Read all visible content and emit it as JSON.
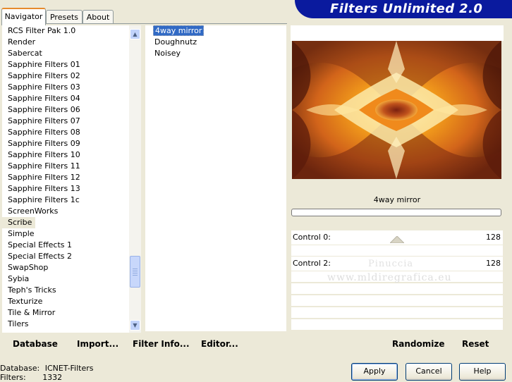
{
  "tabs": {
    "navigator": "Navigator",
    "presets": "Presets",
    "about": "About"
  },
  "app_title": "Filters Unlimited 2.0",
  "categories": [
    "RCS Filter Pak 1.0",
    "Render",
    "Sabercat",
    "Sapphire Filters 01",
    "Sapphire Filters 02",
    "Sapphire Filters 03",
    "Sapphire Filters 04",
    "Sapphire Filters 06",
    "Sapphire Filters 07",
    "Sapphire Filters 08",
    "Sapphire Filters 09",
    "Sapphire Filters 10",
    "Sapphire Filters 11",
    "Sapphire Filters 12",
    "Sapphire Filters 13",
    "Sapphire Filters 1c",
    "ScreenWorks",
    "Scribe",
    "Simple",
    "Special Effects 1",
    "Special Effects 2",
    "SwapShop",
    "Sybia",
    "Teph's Tricks",
    "Texturize",
    "Tile & Mirror",
    "Tilers"
  ],
  "selected_category": "Scribe",
  "filters": [
    "4way mirror",
    "Doughnutz",
    "Noisey"
  ],
  "selected_filter": "4way mirror",
  "preview": {
    "filter_name": "4way mirror"
  },
  "controls": [
    {
      "label": "Control 0:",
      "value": "128"
    },
    {
      "label": "Control 2:",
      "value": "128"
    }
  ],
  "watermark": {
    "line1": "Pinuccia",
    "line2": "www.mldiregrafica.eu"
  },
  "actions": {
    "database": "Database",
    "import": "Import...",
    "filter_info": "Filter Info...",
    "editor": "Editor...",
    "randomize": "Randomize",
    "reset": "Reset"
  },
  "status": {
    "database_label": "Database:",
    "database_value": "ICNET-Filters",
    "filters_label": "Filters:",
    "filters_value": "1332"
  },
  "dialog_buttons": {
    "apply": "Apply",
    "cancel": "Cancel",
    "help": "Help"
  },
  "colors": {
    "banner": "#0a1a9e",
    "selection": "#316ac5",
    "window": "#ece9d8",
    "active_tab_accent": "#e68b2c"
  }
}
